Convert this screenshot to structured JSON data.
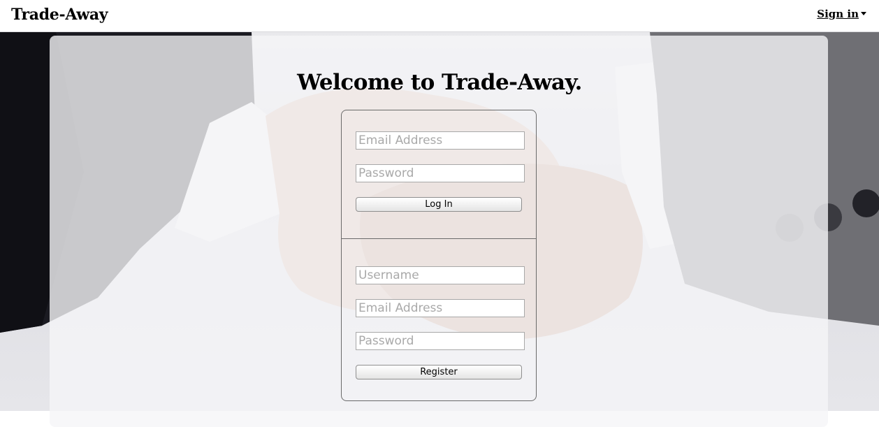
{
  "navbar": {
    "brand": "Trade-Away",
    "signin_label": "Sign in"
  },
  "hero": {
    "welcome": "Welcome to Trade-Away."
  },
  "login": {
    "email_placeholder": "Email Address",
    "password_placeholder": "Password",
    "submit_label": "Log In"
  },
  "register": {
    "username_placeholder": "Username",
    "email_placeholder": "Email Address",
    "password_placeholder": "Password",
    "submit_label": "Register"
  },
  "icons": {
    "signin_caret": "chevron-down-icon"
  },
  "colors": {
    "background": "#ffffff",
    "panel": "#f5f5f7",
    "border": "#6a6a6a",
    "placeholder": "#a9a9a9"
  }
}
